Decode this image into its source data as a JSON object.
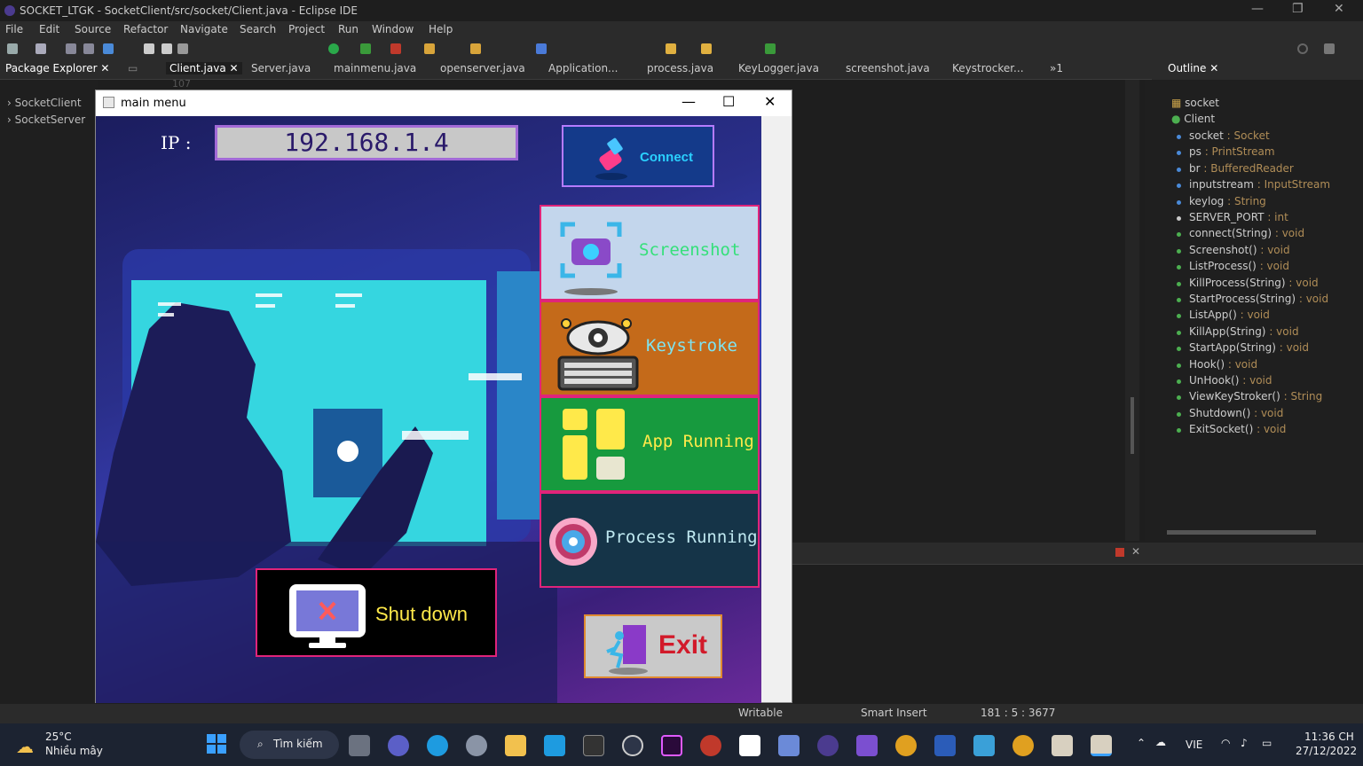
{
  "window_title": "SOCKET_LTGK - SocketClient/src/socket/Client.java - Eclipse IDE",
  "menu": [
    "File",
    "Edit",
    "Source",
    "Refactor",
    "Navigate",
    "Search",
    "Project",
    "Run",
    "Window",
    "Help"
  ],
  "package_explorer": {
    "title": "Package Explorer",
    "items": [
      "SocketClient",
      "SocketServer"
    ]
  },
  "editor_tabs": [
    "Client.java",
    "Server.java",
    "mainmenu.java",
    "openserver.java",
    "Application...",
    "process.java",
    "KeyLogger.java",
    "screenshot.java",
    "Keystrocker...",
    "»1"
  ],
  "outline": {
    "title": "Outline",
    "package": "socket",
    "class": "Client",
    "members": [
      {
        "name": "socket",
        "type": " : Socket",
        "kind": "field"
      },
      {
        "name": "ps",
        "type": " : PrintStream",
        "kind": "field"
      },
      {
        "name": "br",
        "type": " : BufferedReader",
        "kind": "field"
      },
      {
        "name": "inputstream",
        "type": " : InputStream",
        "kind": "field"
      },
      {
        "name": "keylog",
        "type": " : String",
        "kind": "field"
      },
      {
        "name": "SERVER_PORT",
        "type": " : int",
        "kind": "const"
      },
      {
        "name": "connect(String)",
        "type": " : void",
        "kind": "method"
      },
      {
        "name": "Screenshot()",
        "type": " : void",
        "kind": "method"
      },
      {
        "name": "ListProcess()",
        "type": " : void",
        "kind": "method"
      },
      {
        "name": "KillProcess(String)",
        "type": " : void",
        "kind": "method"
      },
      {
        "name": "StartProcess(String)",
        "type": " : void",
        "kind": "method"
      },
      {
        "name": "ListApp()",
        "type": " : void",
        "kind": "method"
      },
      {
        "name": "KillApp(String)",
        "type": " : void",
        "kind": "method"
      },
      {
        "name": "StartApp(String)",
        "type": " : void",
        "kind": "method"
      },
      {
        "name": "Hook()",
        "type": " : void",
        "kind": "method"
      },
      {
        "name": "UnHook()",
        "type": " : void",
        "kind": "method"
      },
      {
        "name": "ViewKeyStroker()",
        "type": " : String",
        "kind": "method"
      },
      {
        "name": "Shutdown()",
        "type": " : void",
        "kind": "method"
      },
      {
        "name": "ExitSocket()",
        "type": " : void",
        "kind": "method"
      }
    ]
  },
  "editor_line_hint": "107",
  "status": {
    "writable": "Writable",
    "insert": "Smart Insert",
    "position": "181 : 5 : 3677"
  },
  "app": {
    "title": "main menu",
    "ip_label": "IP :",
    "ip_value": "192.168.1.4",
    "connect": "Connect",
    "screenshot": "Screenshot",
    "keystroke": "Keystroke",
    "app_running": "App Running",
    "process_running": "Process Running",
    "shutdown": "Shut down",
    "exit": "Exit"
  },
  "taskbar": {
    "weather_temp": "25°C",
    "weather_desc": "Nhiều mây",
    "search": "Tìm kiếm",
    "lang": "VIE",
    "time": "11:36 CH",
    "date": "27/12/2022"
  }
}
